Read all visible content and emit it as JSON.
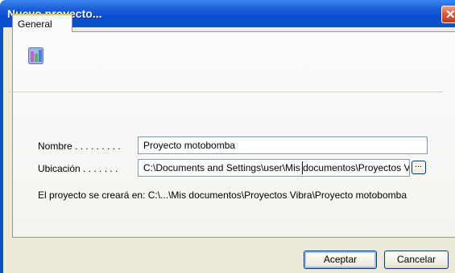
{
  "window": {
    "title": "Nuevo proyecto...",
    "close_label": "✕"
  },
  "tabs": [
    {
      "label": "General"
    }
  ],
  "form": {
    "name_label": "Nombre . . . . . . . . .",
    "name_value": "Proyecto motobomba",
    "location_label": "Ubicación . . . . . . .",
    "location_value": "C:\\Documents and Settings\\user\\Mis documentos\\Proyectos Vibra",
    "browse_label": "...",
    "note": "El proyecto se creará en: C:\\...\\Mis documentos\\Proyectos Vibra\\Proyecto motobomba"
  },
  "buttons": {
    "ok": "Aceptar",
    "cancel": "Cancelar"
  },
  "icons": {
    "close": "close-icon",
    "project": "project-icon"
  },
  "colors": {
    "titlebar": "#0a4dd4",
    "dialog_bg": "#ece9d8",
    "tab_highlight": "#ffc83c",
    "close": "#dd5a3a"
  }
}
